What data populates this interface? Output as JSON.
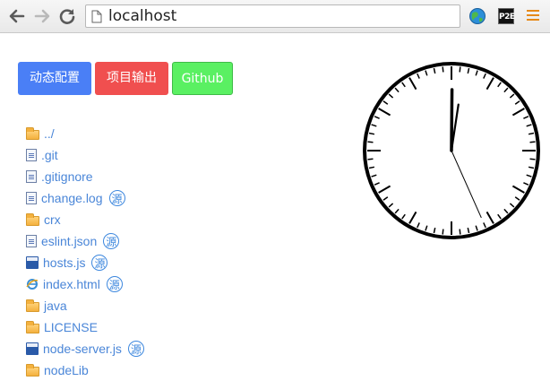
{
  "browser": {
    "url": "localhost",
    "extensions": {
      "p2e_label": "P2E"
    }
  },
  "buttons": {
    "config_label": "动态配置",
    "export_label": "项目输出",
    "github_label": "Github"
  },
  "files": [
    {
      "name": "../",
      "type": "folder",
      "has_source": false
    },
    {
      "name": ".git",
      "type": "doc",
      "has_source": false
    },
    {
      "name": ".gitignore",
      "type": "doc",
      "has_source": false
    },
    {
      "name": "change.log",
      "type": "doc",
      "has_source": true
    },
    {
      "name": "crx",
      "type": "folder",
      "has_source": false
    },
    {
      "name": "eslint.json",
      "type": "doc",
      "has_source": true
    },
    {
      "name": "hosts.js",
      "type": "js",
      "has_source": true
    },
    {
      "name": "index.html",
      "type": "html",
      "has_source": true
    },
    {
      "name": "java",
      "type": "folder",
      "has_source": false
    },
    {
      "name": "LICENSE",
      "type": "folder",
      "has_source": false
    },
    {
      "name": "node-server.js",
      "type": "js",
      "has_source": true
    },
    {
      "name": "nodeLib",
      "type": "folder",
      "has_source": false
    }
  ],
  "source_badge": "源",
  "clock": {
    "hour": 12,
    "minute": 1,
    "second": 26
  },
  "colors": {
    "config_button": "#4a7ff6",
    "export_button": "#f04f4f",
    "github_button": "#5af062",
    "link": "#4a86d8"
  },
  "icons": {
    "back": "arrow-left",
    "forward": "arrow-right",
    "reload": "reload",
    "page": "page",
    "extension_globe": "globe",
    "menu": "hamburger"
  }
}
